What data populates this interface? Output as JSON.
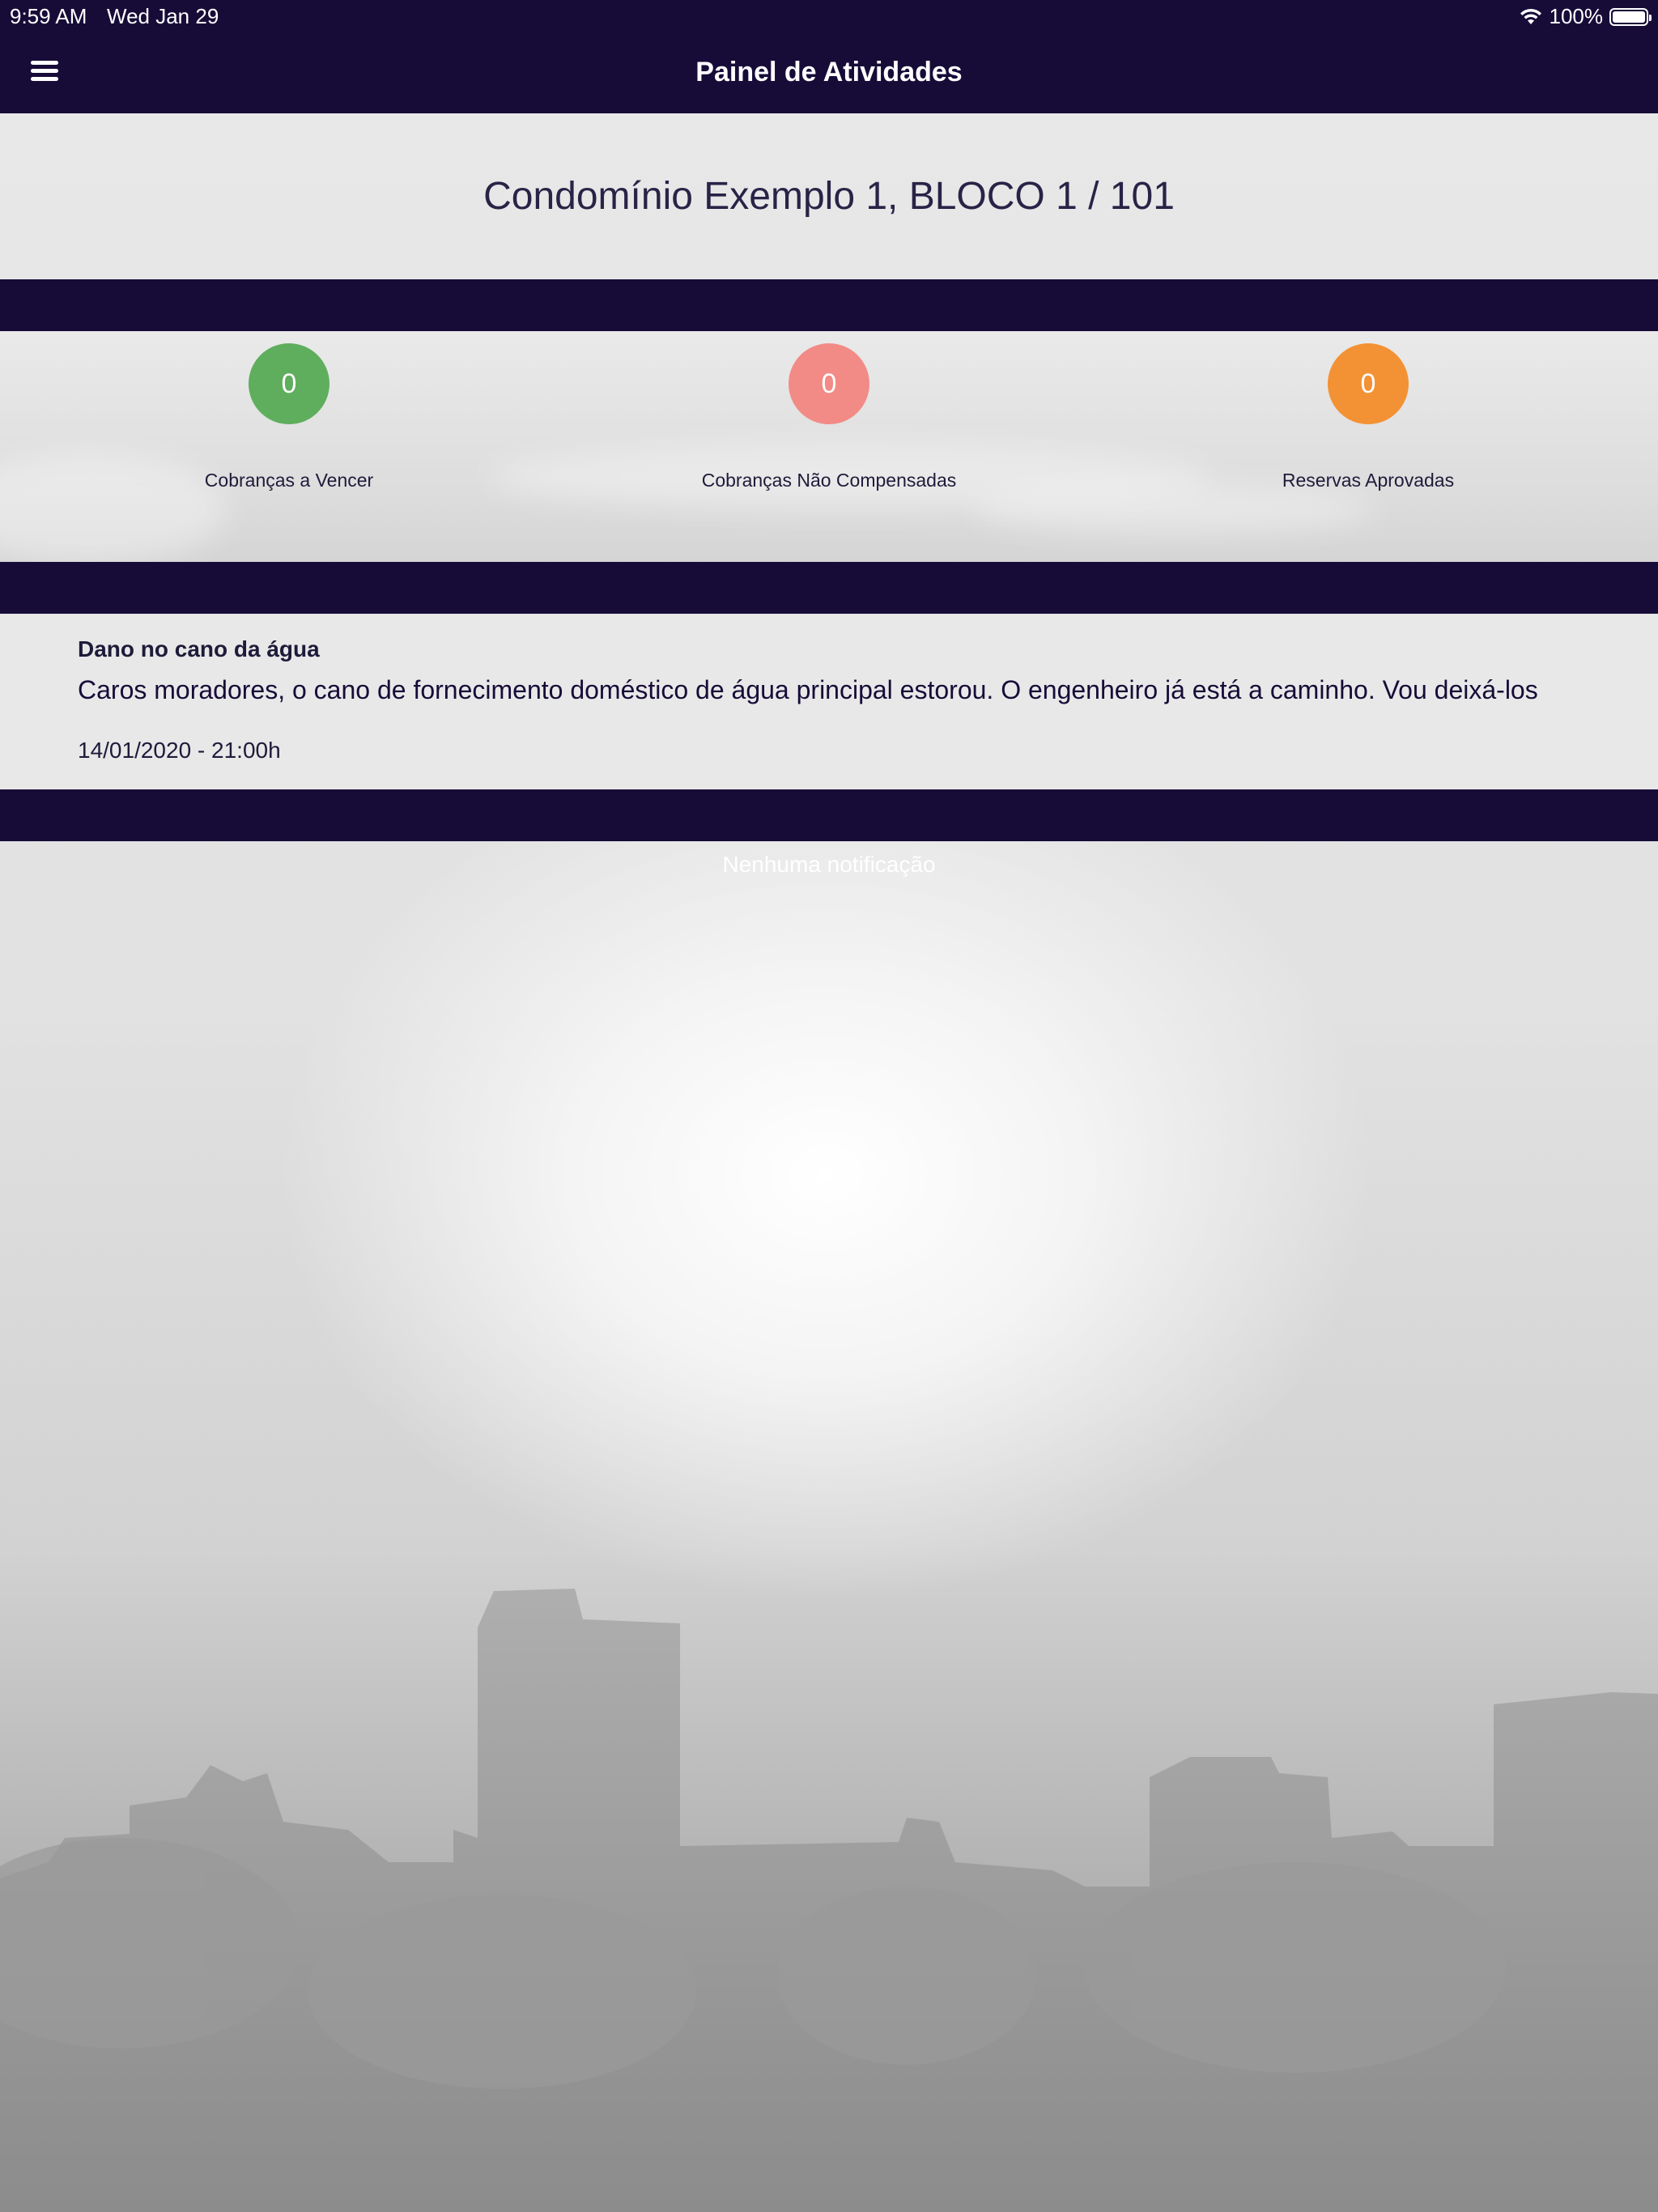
{
  "status_bar": {
    "time": "9:59 AM",
    "date": "Wed Jan 29",
    "battery": "100%"
  },
  "nav": {
    "title": "Painel de Atividades",
    "menu_icon": "hamburger-menu-icon"
  },
  "condo": {
    "title": "Condomínio Exemplo 1, BLOCO 1 / 101"
  },
  "stats": [
    {
      "value": "0",
      "label": "Cobranças a Vencer",
      "color": "#5fae5d"
    },
    {
      "value": "0",
      "label": "Cobranças Não Compensadas",
      "color": "#f28b86"
    },
    {
      "value": "0",
      "label": "Reservas Aprovadas",
      "color": "#f39234"
    }
  ],
  "notice": {
    "title": "Dano no cano da água",
    "body": "Caros moradores, o cano de fornecimento doméstico de água principal estorou. O engenheiro já está a caminho. Vou deixá-los",
    "date": "14/01/2020 - 21:00h"
  },
  "notifications": {
    "empty_text": "Nenhuma notificação"
  },
  "colors": {
    "bar": "#170c38",
    "text_dark": "#1e1b3a"
  }
}
